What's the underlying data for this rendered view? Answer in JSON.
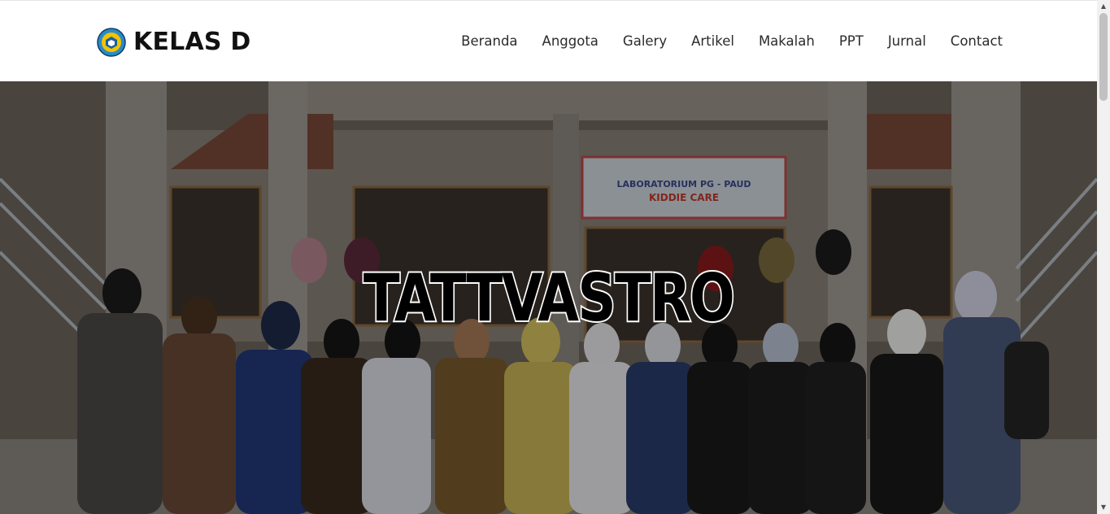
{
  "site": {
    "brand": "KELAS D",
    "logo_icon": "school-emblem-icon"
  },
  "nav": {
    "items": [
      {
        "label": "Beranda"
      },
      {
        "label": "Anggota"
      },
      {
        "label": "Galery"
      },
      {
        "label": "Artikel"
      },
      {
        "label": "Makalah"
      },
      {
        "label": "PPT"
      },
      {
        "label": "Jurnal"
      },
      {
        "label": "Contact"
      }
    ]
  },
  "hero": {
    "title": "TATTVASTRO",
    "sign_line1": "LABORATORIUM PG - PAUD",
    "sign_line2": "KIDDIE CARE"
  },
  "colors": {
    "header_bg": "#ffffff",
    "text": "#111111",
    "hero_title_stroke": "#ffffff"
  }
}
